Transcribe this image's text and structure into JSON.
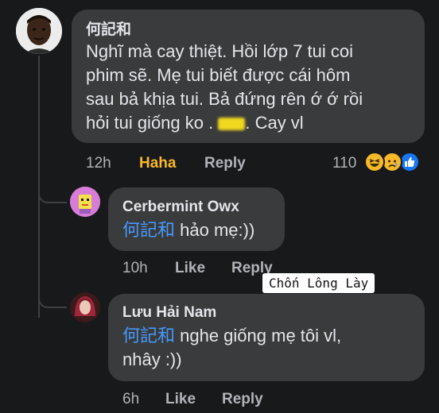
{
  "comments": [
    {
      "author": "何記和",
      "lines": [
        "Nghĩ mà cay thiệt. Hồi lớp 7 tui coi",
        "phim sẽ. Mẹ tui biết được cái hôm",
        "sau bả khịa tui. Bả đứng rên ớ ớ rồi"
      ],
      "last_line_prefix": "hỏi tui giống ko . ",
      "last_line_suffix": ". Cay vl",
      "timestamp": "12h",
      "reaction_label": "Haha",
      "reply_label": "Reply",
      "reaction_count": "110"
    },
    {
      "author": "Cerbermint Owx",
      "mention": "何記和",
      "text": " hảo mẹ:))",
      "timestamp": "10h",
      "like_label": "Like",
      "reply_label": "Reply"
    },
    {
      "author": "Lưu Hải Nam",
      "mention": "何記和",
      "text_line1": " nghe giống mẹ tôi vl,",
      "text_line2": "nhây :))",
      "timestamp": "6h",
      "like_label": "Like",
      "reply_label": "Reply"
    }
  ],
  "watermark": "Chốn Lông Lày",
  "colors": {
    "background": "#18191a",
    "bubble": "#3a3b3c",
    "mention": "#4599ff",
    "haha_active": "#f7b928",
    "secondary_text": "#b0b3b8"
  },
  "icons": [
    "haha-reaction-icon",
    "sad-reaction-icon",
    "like-reaction-icon"
  ]
}
